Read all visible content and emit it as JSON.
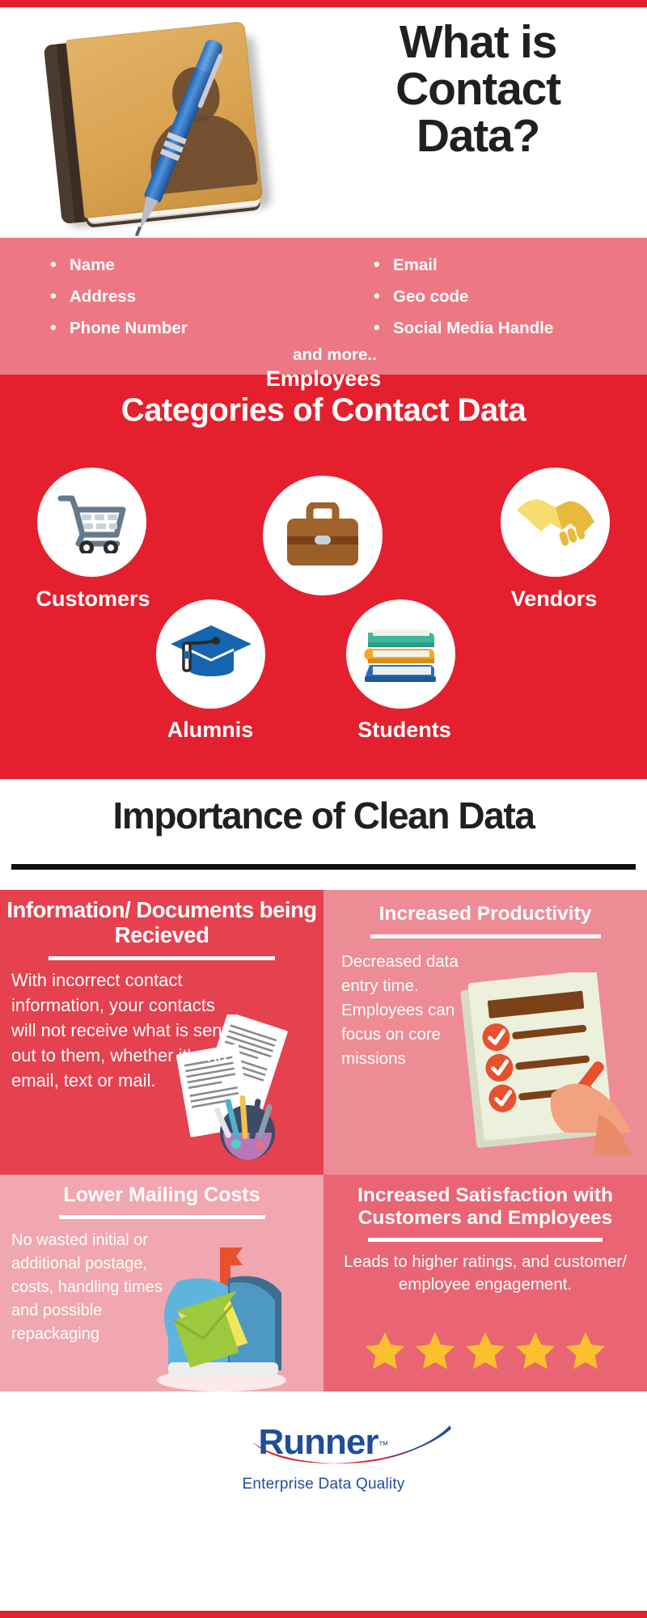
{
  "theme": {
    "red": "#E5202E",
    "pink_band": "#ED7883",
    "quad1": "#E5414F",
    "quad2": "#ED8C95",
    "quad3": "#F0A7AF",
    "quad4": "#E96573",
    "dark_text": "#231F20",
    "logo_blue": "#1F4E9C",
    "star_yellow": "#FBC02D"
  },
  "header": {
    "title_line1": "What is",
    "title_line2": "Contact",
    "title_line3": "Data?",
    "art_icon": "contacts-notebook-with-pen-illustration"
  },
  "attributes": {
    "left_column": [
      "Name",
      "Address",
      "Phone Number"
    ],
    "right_column": [
      "Email",
      "Geo code",
      "Social Media Handle"
    ],
    "footnote": "and more.."
  },
  "categories": {
    "heading": "Categories of Contact Data",
    "items": [
      {
        "label": "Customers",
        "icon": "shopping-cart-icon"
      },
      {
        "label": "Employees",
        "icon": "briefcase-icon"
      },
      {
        "label": "Vendors",
        "icon": "handshake-icon"
      },
      {
        "label": "Alumnis",
        "icon": "graduation-cap-icon"
      },
      {
        "label": "Students",
        "icon": "stack-of-books-icon"
      }
    ]
  },
  "importance": {
    "heading": "Importance of Clean Data",
    "quadrants": [
      {
        "title": "Information/ Documents being Recieved",
        "body": "With incorrect contact information, your contacts will not receive what is sent out to them, whether it's via email, text or mail.",
        "art_icon": "scattered-documents-and-stationery-illustration"
      },
      {
        "title": "Increased Productivity",
        "body": "Decreased data entry time. Employees can focus on core missions",
        "art_icon": "checklist-with-hand-and-pen-illustration"
      },
      {
        "title": "Lower Mailing Costs",
        "body": "No wasted initial or additional postage, costs, handling times and possible repackaging",
        "art_icon": "mailbox-with-envelopes-illustration"
      },
      {
        "title": "Increased Satisfaction with Customers and Employees",
        "body": "Leads to higher ratings, and customer/ employee engagement.",
        "art_icon": "five-star-rating-icon",
        "star_count": 5
      }
    ]
  },
  "footer": {
    "brand": "Runner",
    "brand_tm": "™",
    "tagline": "Enterprise Data Quality",
    "logo_icon": "runner-swoosh-logo"
  }
}
